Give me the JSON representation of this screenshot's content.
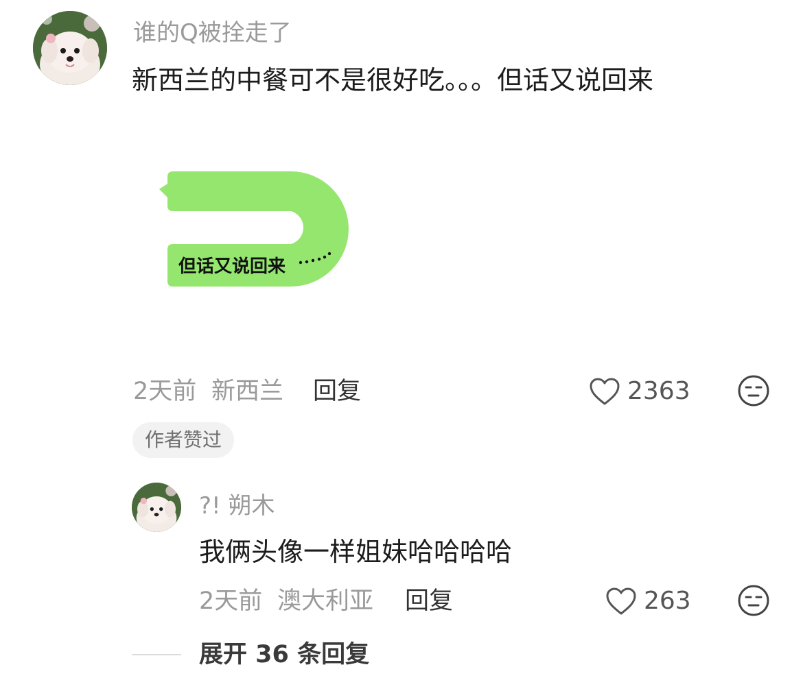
{
  "comment": {
    "username": "谁的Q被拴走了",
    "text": "新西兰的中餐可不是很好吃。。。但话又说回来",
    "sticker_text": "但话又说回来",
    "sticker_color": "#95e66f",
    "time": "2天前",
    "location": "新西兰",
    "reply_label": "回复",
    "likes": "2363",
    "author_badge": "作者赞过",
    "avatar_icon": "dog-avatar-icon"
  },
  "reply": {
    "username": "?! 朔木",
    "text": "我俩头像一样姐妹哈哈哈哈",
    "time": "2天前",
    "location": "澳大利亚",
    "reply_label": "回复",
    "likes": "263",
    "avatar_icon": "dog-avatar-icon"
  },
  "expand": {
    "label": "展开 36 条回复"
  },
  "icons": {
    "like": "heart-outline-icon",
    "dislike": "meh-face-icon"
  }
}
